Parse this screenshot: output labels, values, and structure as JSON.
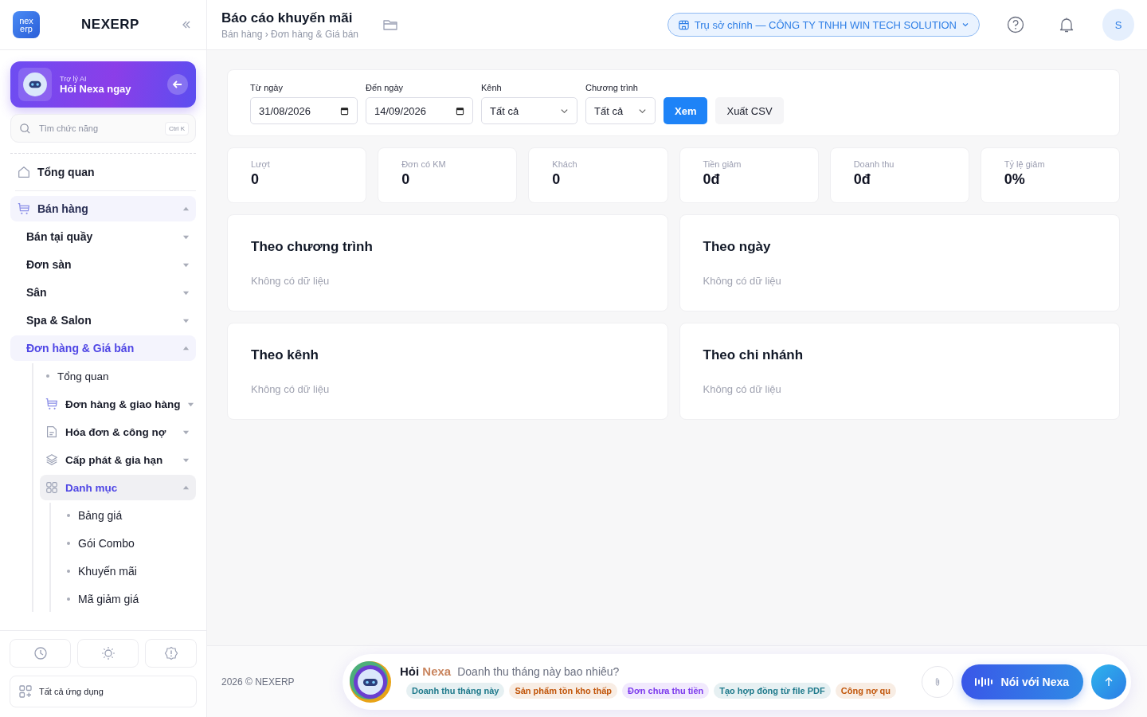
{
  "sidebar": {
    "logo": {
      "line1": "nex",
      "line2": "erp"
    },
    "brand": "NEXERP",
    "assistant": {
      "caption": "Trợ lý AI",
      "title": "Hỏi Nexa ngay"
    },
    "search": {
      "placeholder": "Tìm chức năng",
      "shortcut": "Ctrl K"
    },
    "pinned": {
      "label": "Tổng quan",
      "kind": "home",
      "selected": false
    },
    "menu": [
      {
        "label": "Bán hàng",
        "kind": "cart",
        "selected": true,
        "expanded": true,
        "children": [
          {
            "label": "Bán tại quầy",
            "selected": false,
            "expanded": false
          },
          {
            "label": "Đơn sàn",
            "selected": false,
            "expanded": false
          },
          {
            "label": "Sân",
            "selected": false,
            "expanded": false
          },
          {
            "label": "Spa & Salon",
            "selected": false,
            "expanded": false
          },
          {
            "label": "Đơn hàng & Giá bán",
            "selected": true,
            "expanded": true,
            "children": [
              {
                "label": "Tổng quan",
                "kind": "dot",
                "selected": false
              },
              {
                "label": "Đơn hàng & giao hàng",
                "kind": "cart",
                "selected": false,
                "expanded": false
              },
              {
                "label": "Hóa đơn & công nợ",
                "kind": "invoice",
                "selected": false,
                "expanded": false
              },
              {
                "label": "Cấp phát & gia hạn",
                "kind": "layers",
                "selected": false,
                "expanded": false
              },
              {
                "label": "Danh mục",
                "kind": "grid",
                "selected": true,
                "expanded": true,
                "children": [
                  {
                    "label": "Bảng giá",
                    "kind": "dot",
                    "selected": false
                  },
                  {
                    "label": "Gói Combo",
                    "kind": "dot",
                    "selected": false
                  },
                  {
                    "label": "Khuyến mãi",
                    "kind": "dot",
                    "selected": false
                  },
                  {
                    "label": "Mã giảm giá",
                    "kind": "dot",
                    "selected": false
                  }
                ]
              }
            ]
          }
        ]
      }
    ],
    "all_apps": "Tất cả ứng dụng"
  },
  "header": {
    "title": "Báo cáo khuyến mãi",
    "breadcrumb": "Bán hàng › Đơn hàng & Giá bán",
    "branch": "Trụ sở chính — CÔNG TY TNHH WIN TECH SOLUTION",
    "avatar": "S"
  },
  "filters": [
    {
      "kind": "date",
      "label": "Từ ngày",
      "value": "31/08/2026"
    },
    {
      "kind": "date",
      "label": "Đến ngày",
      "value": "14/09/2026"
    },
    {
      "kind": "select",
      "label": "Kênh",
      "value": "Tất cả"
    },
    {
      "kind": "select",
      "label": "Chương trình",
      "value": "Tất cả"
    }
  ],
  "buttons": [
    {
      "label": "Xem",
      "kind": "primary"
    },
    {
      "label": "Xuất CSV",
      "kind": "secondary"
    }
  ],
  "stats": [
    {
      "label": "Lượt",
      "value": "0"
    },
    {
      "label": "Đơn có KM",
      "value": "0"
    },
    {
      "label": "Khách",
      "value": "0"
    },
    {
      "label": "Tiền giảm",
      "value": "0đ"
    },
    {
      "label": "Doanh thu",
      "value": "0đ"
    },
    {
      "label": "Tỷ lệ giảm",
      "value": "0%"
    }
  ],
  "panels": [
    {
      "title": "Theo chương trình",
      "empty": "Không có dữ liệu"
    },
    {
      "title": "Theo ngày",
      "empty": "Không có dữ liệu"
    },
    {
      "title": "Theo kênh",
      "empty": "Không có dữ liệu"
    },
    {
      "title": "Theo chi nhánh",
      "empty": "Không có dữ liệu"
    }
  ],
  "footer": {
    "copyright": "2026 © NEXERP"
  },
  "chat": {
    "ask": "Hỏi",
    "brand": "Nexa",
    "placeholder": "Doanh thu tháng này bao nhiêu?",
    "chips": [
      {
        "label": "Doanh thu tháng này",
        "color": "#1f7a8c"
      },
      {
        "label": "Sản phẩm tồn kho thấp",
        "color": "#c2570c"
      },
      {
        "label": "Đơn chưa thu tiền",
        "color": "#7c3aed"
      },
      {
        "label": "Tạo hợp đồng từ file PDF",
        "color": "#1f7a8c"
      },
      {
        "label": "Công nợ qu",
        "color": "#c2570c"
      }
    ],
    "voice": "Nói với Nexa"
  }
}
